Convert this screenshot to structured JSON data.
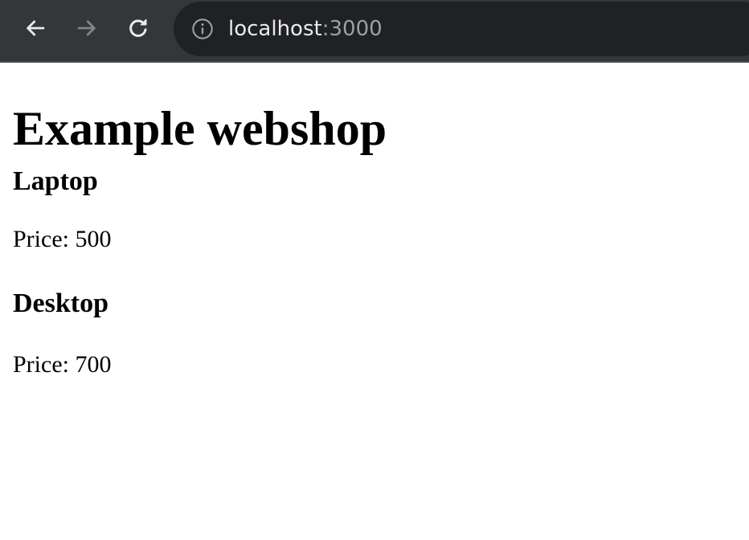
{
  "browser": {
    "url_host": "localhost",
    "url_port": ":3000",
    "icons": {
      "back": "arrow-left-icon",
      "forward": "arrow-right-icon",
      "reload": "reload-icon",
      "info": "info-icon"
    },
    "colors": {
      "toolbar": "#35363a",
      "address_bar": "#202124",
      "icon_active": "#e8eaed",
      "icon_disabled": "#80868b"
    }
  },
  "page": {
    "title": "Example webshop",
    "products": [
      {
        "name": "Laptop",
        "price": "Price: 500"
      },
      {
        "name": "Desktop",
        "price": "Price: 700"
      }
    ]
  }
}
